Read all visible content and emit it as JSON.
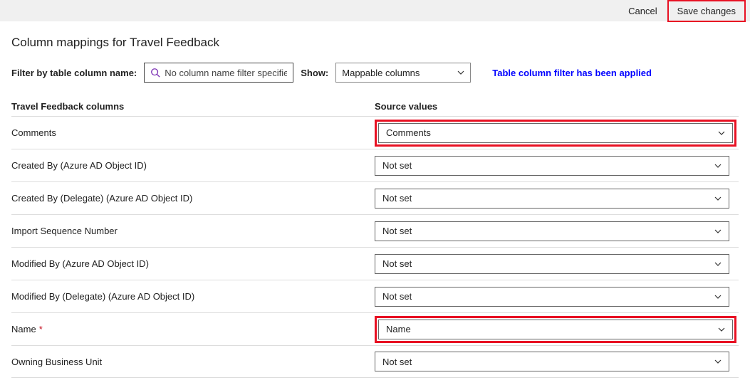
{
  "topbar": {
    "cancel_label": "Cancel",
    "save_label": "Save changes"
  },
  "page_title": "Column mappings for Travel Feedback",
  "filter": {
    "label": "Filter by table column name:",
    "placeholder": "No column name filter specified",
    "show_label": "Show:",
    "show_value": "Mappable columns",
    "applied_msg": "Table column filter has been applied"
  },
  "grid": {
    "left_header": "Travel Feedback columns",
    "right_header": "Source values",
    "rows": [
      {
        "label": "Comments",
        "value": "Comments",
        "required": false,
        "highlight": true
      },
      {
        "label": "Created By (Azure AD Object ID)",
        "value": "Not set",
        "required": false,
        "highlight": false
      },
      {
        "label": "Created By (Delegate) (Azure AD Object ID)",
        "value": "Not set",
        "required": false,
        "highlight": false
      },
      {
        "label": "Import Sequence Number",
        "value": "Not set",
        "required": false,
        "highlight": false
      },
      {
        "label": "Modified By (Azure AD Object ID)",
        "value": "Not set",
        "required": false,
        "highlight": false
      },
      {
        "label": "Modified By (Delegate) (Azure AD Object ID)",
        "value": "Not set",
        "required": false,
        "highlight": false
      },
      {
        "label": "Name",
        "value": "Name",
        "required": true,
        "highlight": true
      },
      {
        "label": "Owning Business Unit",
        "value": "Not set",
        "required": false,
        "highlight": false
      }
    ]
  }
}
